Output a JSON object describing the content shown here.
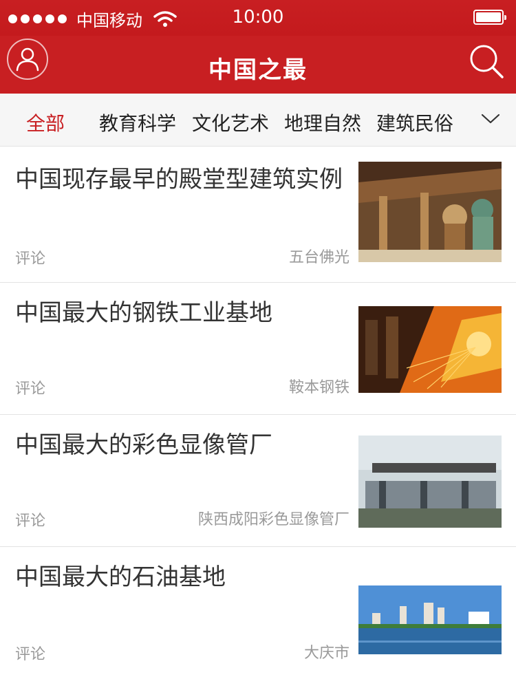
{
  "status_bar": {
    "carrier": "中国移动",
    "time": "10:00"
  },
  "header": {
    "title": "中国之最"
  },
  "tabs": [
    {
      "label": "全部"
    },
    {
      "label": "教育科学"
    },
    {
      "label": "文化艺术"
    },
    {
      "label": "地理自然"
    },
    {
      "label": "建筑民俗"
    }
  ],
  "articles": [
    {
      "title": "中国现存最早的殿堂型建筑实例",
      "comment": "评论",
      "source": "五台佛光",
      "image": "temple-interior-photo"
    },
    {
      "title": "中国最大的钢铁工业基地",
      "comment": "评论",
      "source": "鞍本钢铁",
      "image": "steel-sparks-photo"
    },
    {
      "title": "中国最大的彩色显像管厂",
      "comment": "评论",
      "source": "陕西成阳彩色显像管厂",
      "image": "factory-gate-photo"
    },
    {
      "title": "中国最大的石油基地",
      "comment": "评论",
      "source": "大庆市",
      "image": "city-skyline-photo"
    }
  ],
  "colors": {
    "brand_red": "#c81f22",
    "text": "#333333",
    "meta": "#9a9a9a"
  }
}
